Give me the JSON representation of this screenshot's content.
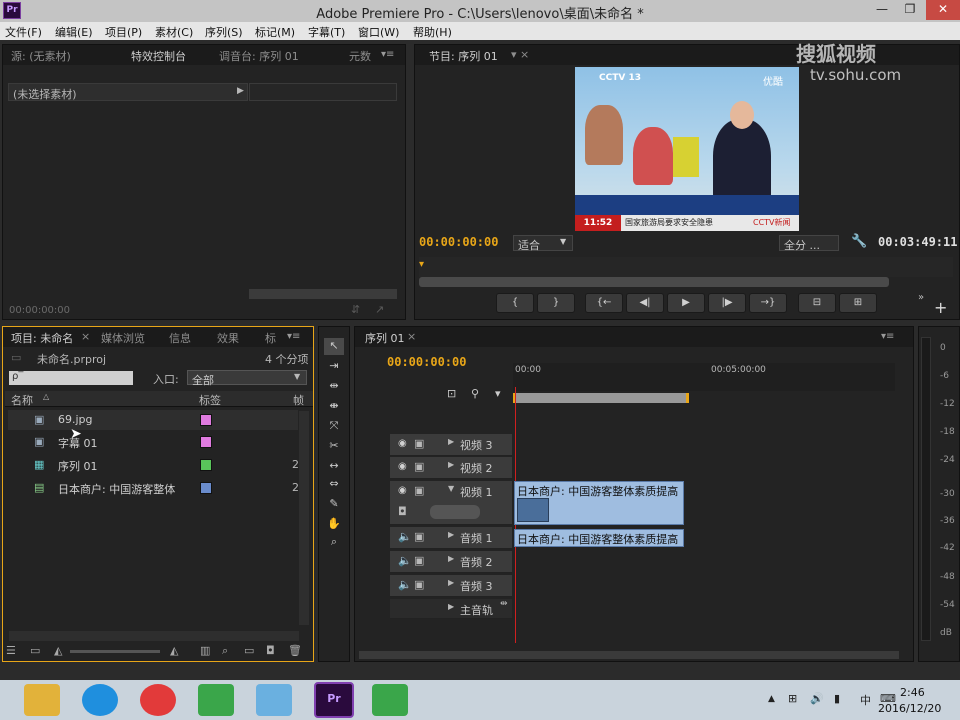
{
  "titlebar": {
    "app_icon": "Pr",
    "title": "Adobe Premiere Pro - C:\\Users\\lenovo\\桌面\\未命名 *",
    "buttons": {
      "minimize": "—",
      "restore": "❐",
      "close": "✕"
    }
  },
  "menubar": [
    "文件(F)",
    "编辑(E)",
    "项目(P)",
    "素材(C)",
    "序列(S)",
    "标记(M)",
    "字幕(T)",
    "窗口(W)",
    "帮助(H)"
  ],
  "source_panel": {
    "tabs": [
      "源: (无素材)",
      "特效控制台",
      "调音台: 序列 01",
      "元数"
    ],
    "no_clip": "(未选择素材)",
    "timecode": "00:00:00:00"
  },
  "program_monitor": {
    "tab": "节目: 序列 01",
    "timecode": "00:00:00:00",
    "fit": "适合",
    "quality": "全分 ...",
    "duration": "00:03:49:11",
    "video": {
      "channel": "CCTV 13",
      "watermark": "优酷",
      "ticker_time": "11:52",
      "ticker_text": "国家旅游局要求安全隐患",
      "corner_text": "CCTV新闻"
    },
    "controls": [
      "{",
      "}",
      "{←",
      "◀|",
      "▶",
      "|▶",
      "→}"
    ]
  },
  "watermark": {
    "logo": "搜狐视频",
    "url": "tv.sohu.com"
  },
  "project_panel": {
    "tabs": [
      "项目: 未命名",
      "媒体浏览",
      "信息",
      "效果",
      "标"
    ],
    "project_file": "未命名.prproj",
    "item_count": "4 个分项",
    "search_placeholder": "ρ‾",
    "in_label": "入口:",
    "in_value": "全部",
    "columns": [
      "名称",
      "标签",
      "帧"
    ],
    "items": [
      {
        "name": "69.jpg",
        "color": "#e07be0",
        "extra": ""
      },
      {
        "name": "字幕 01",
        "color": "#e07be0",
        "extra": ""
      },
      {
        "name": "序列 01",
        "color": "#59c45a",
        "extra": "2"
      },
      {
        "name": "日本商户: 中国游客整体",
        "color": "#6a8ccc",
        "extra": "2"
      }
    ]
  },
  "timeline": {
    "tab": "序列 01",
    "timecode": "00:00:00:00",
    "ruler": [
      "00:00",
      "00:05:00:00"
    ],
    "tracks": [
      {
        "name": "视频 3",
        "type": "video"
      },
      {
        "name": "视频 2",
        "type": "video"
      },
      {
        "name": "视频 1",
        "type": "video"
      },
      {
        "name": "音频 1",
        "type": "audio"
      },
      {
        "name": "音频 2",
        "type": "audio"
      },
      {
        "name": "音频 3",
        "type": "audio"
      },
      {
        "name": "主音轨",
        "type": "master"
      }
    ],
    "clip_video": "日本商户: 中国游客整体素质提高",
    "clip_audio": "日本商户: 中国游客整体素质提高"
  },
  "audio_meter": {
    "labels": [
      "0",
      "-6",
      "-12",
      "-18",
      "-24",
      "-30",
      "-36",
      "-42",
      "-48",
      "-54",
      "dB"
    ]
  },
  "taskbar": {
    "time": "2:46",
    "date": "2016/12/20",
    "ime": "中",
    "apps": [
      "file-explorer-icon",
      "skype-icon",
      "media-player-icon",
      "camtasia-icon",
      "notepad-icon",
      "premiere-icon",
      "camtasia-recorder-icon"
    ]
  }
}
